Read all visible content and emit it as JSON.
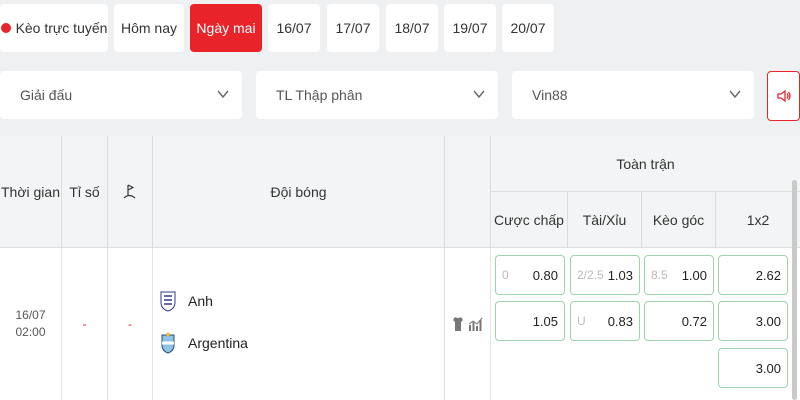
{
  "date_tabs": {
    "live": "Kèo trực tuyến",
    "today": "Hôm nay",
    "tomorrow": "Ngày mai",
    "d1": "16/07",
    "d2": "17/07",
    "d3": "18/07",
    "d4": "19/07",
    "d5": "20/07"
  },
  "filters": {
    "league": "Giải đấu",
    "odds_format": "TL Thập phân",
    "bookmaker": "Vin88"
  },
  "colors": {
    "accent": "#e8232a",
    "odds_border": "#9ed3ad",
    "header_bg": "#f3f4f5"
  },
  "table": {
    "headers": {
      "time": "Thời gian",
      "score": "Tỉ số",
      "teams": "Đội bóng",
      "full_match": "Toàn trận",
      "handicap": "Cược chấp",
      "over_under": "Tài/Xỉu",
      "corners": "Kèo góc",
      "one_x_two": "1x2"
    },
    "match": {
      "date": "16/07",
      "time": "02:00",
      "score": "-",
      "corner_score": "-",
      "home": "Anh",
      "away": "Argentina",
      "handicap": {
        "line": "0",
        "home": "0.80",
        "away": "1.05"
      },
      "over_under": {
        "line": "2/2.5",
        "over": "1.03",
        "under_label": "U",
        "under": "0.83"
      },
      "corners": {
        "line": "8.5",
        "over": "1.00",
        "under": "0.72"
      },
      "one_x_two": {
        "home": "2.62",
        "away": "3.00",
        "draw": "3.00"
      }
    }
  }
}
